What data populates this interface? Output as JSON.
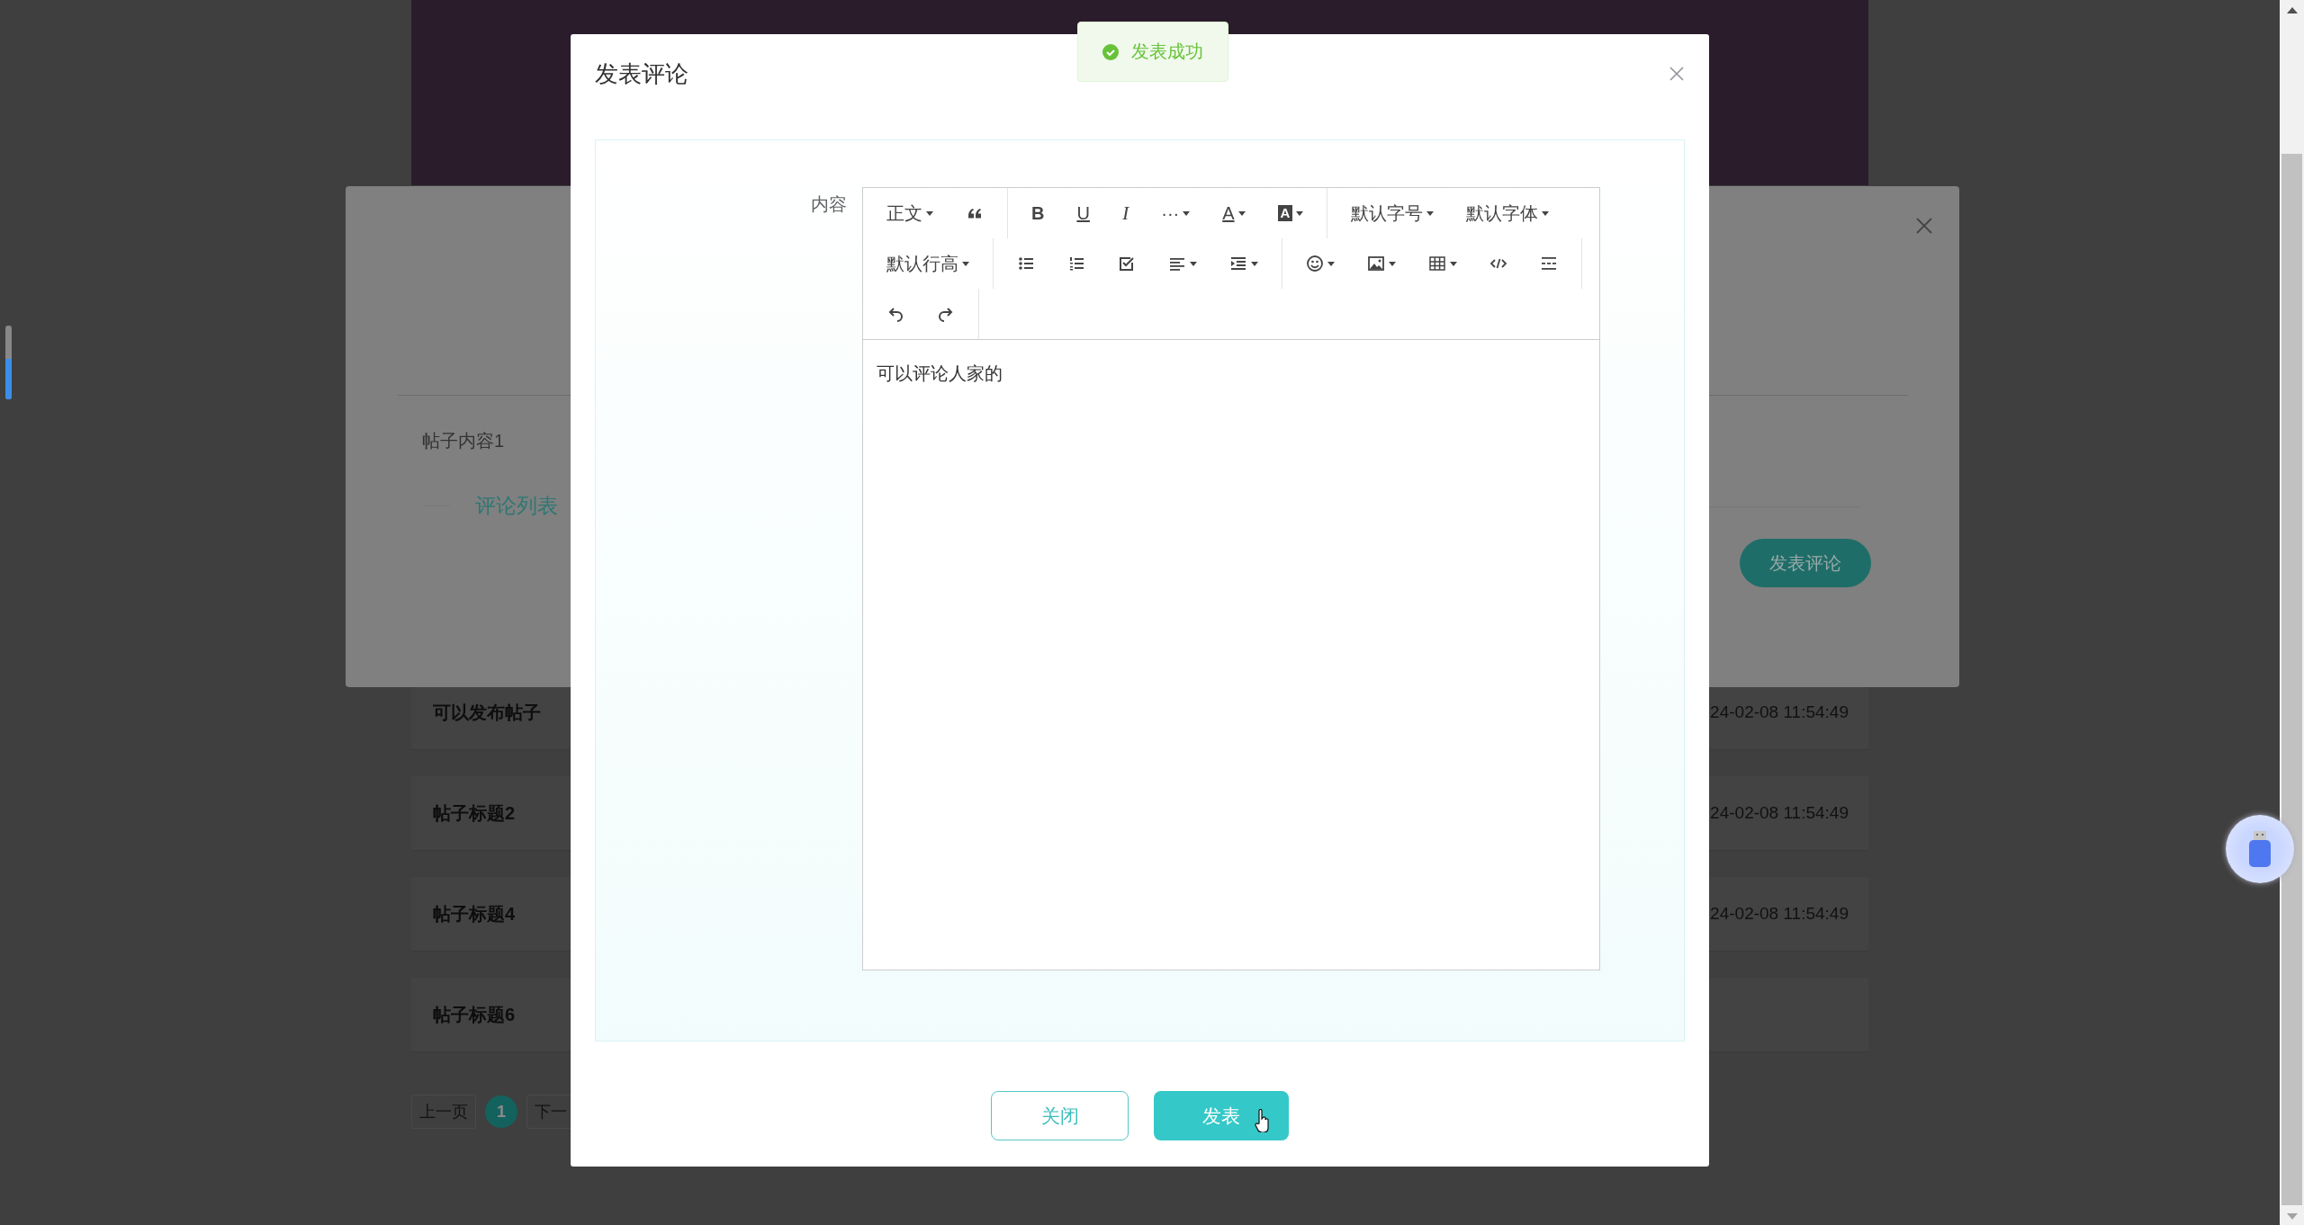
{
  "page": {
    "posts": [
      {
        "title": "可以发布帖子",
        "time": "24-02-08 11:54:49"
      },
      {
        "title": "帖子标题2",
        "time": "24-02-08 11:54:49"
      },
      {
        "title": "帖子标题4",
        "time": "24-02-08 11:54:49"
      },
      {
        "title": "帖子标题6"
      }
    ],
    "pagination": {
      "prev": "上一页",
      "pages": [
        {
          "label": "1",
          "selected": true
        }
      ],
      "next": "下一"
    }
  },
  "post_dialog": {
    "content": "帖子内容1",
    "comments_heading": "评论列表",
    "comment_button": "发表评论"
  },
  "comment_dialog": {
    "title": "发表评论",
    "field_label": "内容",
    "toolbar": [
      [
        [
          {
            "kind": "select",
            "label": "正文",
            "menu": true
          },
          {
            "kind": "quote",
            "menu": false
          }
        ],
        [
          {
            "kind": "bold",
            "label": "B",
            "menu": false
          },
          {
            "kind": "underline",
            "label": "U",
            "menu": false
          },
          {
            "kind": "italic",
            "label": "I",
            "menu": false
          },
          {
            "kind": "more",
            "label": "···",
            "menu": true
          },
          {
            "kind": "font-color",
            "label": "A",
            "menu": true
          },
          {
            "kind": "back-color",
            "label": "A",
            "menu": true
          }
        ],
        [
          {
            "kind": "select",
            "label": "默认字号",
            "menu": true
          },
          {
            "kind": "select",
            "label": "默认字体",
            "menu": true
          }
        ]
      ],
      [
        [
          {
            "kind": "select",
            "label": "默认行高",
            "menu": true
          }
        ],
        [
          {
            "kind": "bullets",
            "menu": false
          },
          {
            "kind": "numbers",
            "menu": false
          },
          {
            "kind": "todo",
            "menu": false
          },
          {
            "kind": "align",
            "menu": true
          },
          {
            "kind": "indent",
            "menu": true
          }
        ],
        [
          {
            "kind": "emoji",
            "menu": true
          },
          {
            "kind": "image",
            "menu": true
          },
          {
            "kind": "table",
            "menu": true
          },
          {
            "kind": "code",
            "menu": false
          },
          {
            "kind": "divider",
            "menu": false
          }
        ]
      ],
      [
        [
          {
            "kind": "undo",
            "menu": false
          },
          {
            "kind": "redo",
            "menu": false
          }
        ]
      ]
    ],
    "value": "可以评论人家的",
    "buttons": [
      {
        "label": "关闭",
        "kind": "secondary"
      },
      {
        "label": "发表",
        "kind": "primary"
      }
    ]
  },
  "toast": {
    "message": "发表成功",
    "kind": "success"
  }
}
